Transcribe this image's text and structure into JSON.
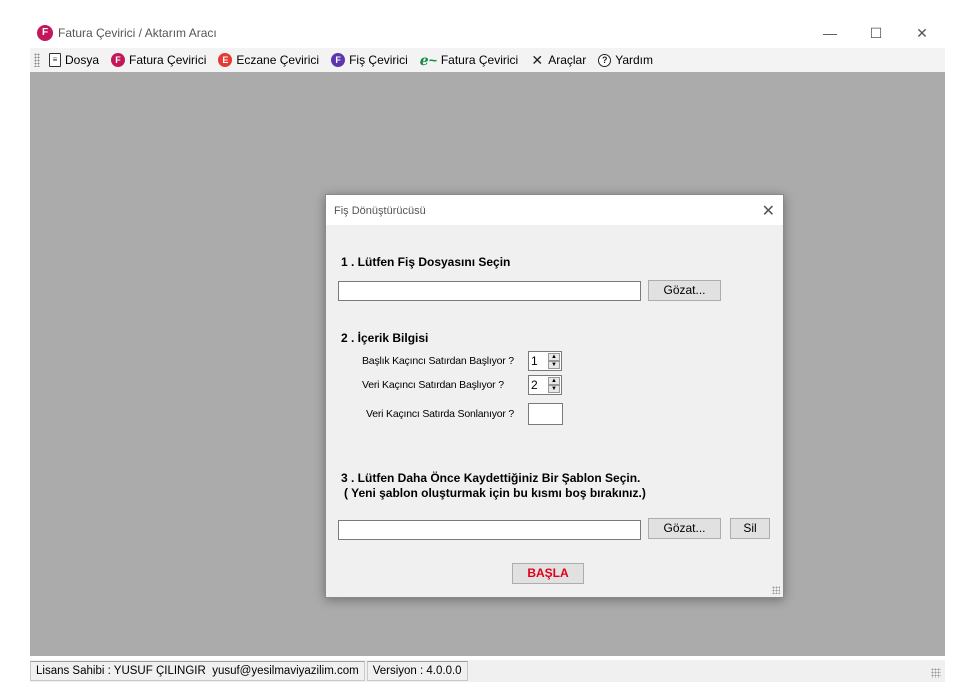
{
  "window": {
    "title": "Fatura Çevirici / Aktarım Aracı",
    "icon_letter": "F",
    "minimize": "—",
    "maximize": "☐",
    "close": "✕"
  },
  "menu": {
    "items": [
      {
        "label": "Dosya",
        "icon": "document-icon"
      },
      {
        "label": "Fatura Çevirici",
        "icon": "fatura-f-icon",
        "letter": "F"
      },
      {
        "label": "Eczane Çevirici",
        "icon": "eczane-e-icon",
        "letter": "E"
      },
      {
        "label": "Fiş Çevirici",
        "icon": "fis-f-icon",
        "letter": "F"
      },
      {
        "label": "Fatura Çevirici",
        "icon": "e-fatura-icon",
        "letter": "ℯ~"
      },
      {
        "label": "Araçlar",
        "icon": "tools-icon",
        "letter": "✕"
      },
      {
        "label": "Yardım",
        "icon": "help-icon",
        "letter": "?"
      }
    ],
    "colors": {
      "fatura": "#c2185b",
      "eczane": "#e53935",
      "fis": "#5e35b1",
      "efatura": "#138a3f"
    }
  },
  "dialog": {
    "title": "Fiş Dönüştürücüsü",
    "close": "✕",
    "section1": "1 . Lütfen Fiş Dosyasını Seçin",
    "browse1": "Gözat...",
    "section2": "2 . İçerik Bilgisi",
    "header_start_label": "Başlık Kaçıncı Satırdan Başlıyor ?",
    "header_start_value": "1",
    "data_start_label": "Veri Kaçıncı Satırdan Başlıyor ?",
    "data_start_value": "2",
    "data_end_label": "Veri Kaçıncı Satırda Sonlanıyor ?",
    "data_end_value": "",
    "section3_line1": "3 . Lütfen Daha Önce Kaydettiğiniz Bir Şablon Seçin.",
    "section3_line2": "( Yeni  şablon oluşturmak için bu kısmı boş bırakınız.)",
    "browse2": "Gözat...",
    "delete": "Sil",
    "start": "BAŞLA",
    "start_color": "#e0001b"
  },
  "status": {
    "license": "Lisans Sahibi : YUSUF ÇILINGIR",
    "email": "yusuf@yesilmaviyazilim.com",
    "version": "Versiyon : 4.0.0.0"
  }
}
